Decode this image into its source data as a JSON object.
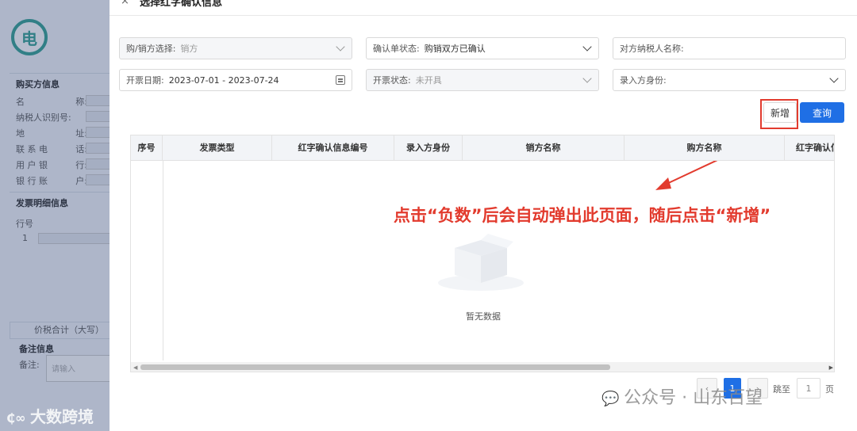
{
  "background_panel": {
    "logo_char": "电",
    "buyer_section": "购买方信息",
    "buyer_fields": [
      {
        "l": "名",
        "r": "称:"
      },
      {
        "l": "纳税人识别号:",
        "r": ""
      },
      {
        "l": "地",
        "r": "址:"
      },
      {
        "l": "联 系 电",
        "r": "话:"
      },
      {
        "l": "用 户 银",
        "r": "行:"
      },
      {
        "l": "银 行 账",
        "r": "户:"
      }
    ],
    "detail_section": "发票明细信息",
    "line_no_label": "行号",
    "line_no_value": "1",
    "total_label": "价税合计（大写）",
    "remark_section": "备注信息",
    "remark_label": "备注:",
    "remark_placeholder": "请输入"
  },
  "dialog": {
    "close_glyph": "×",
    "title": "选择红字确认信息",
    "filters": {
      "role": {
        "label": "购/销方选择:",
        "value": "销方"
      },
      "confirm_status": {
        "label": "确认单状态:",
        "value": "购销双方已确认"
      },
      "counterparty": {
        "label": "对方纳税人名称:",
        "value": ""
      },
      "date": {
        "label": "开票日期:",
        "value": "2023-07-01 - 2023-07-24"
      },
      "invoice_status": {
        "label": "开票状态:",
        "value": "未开具"
      },
      "entry_identity": {
        "label": "录入方身份:",
        "value": ""
      }
    },
    "buttons": {
      "add": "新增",
      "query": "查询"
    },
    "table": {
      "columns": [
        "序号",
        "发票类型",
        "红字确认信息编号",
        "录入方身份",
        "销方名称",
        "购方名称",
        "红字确认信息状态"
      ],
      "empty_text": "暂无数据"
    },
    "annotation": "点击“负数”后会自动弹出此页面，随后点击“新增”",
    "pagination": {
      "prev": "‹",
      "current_page": "1",
      "next": "›",
      "jump_label": "跳至",
      "jump_value": "1",
      "page_unit": "页"
    }
  },
  "watermarks": {
    "left": "大数跨境",
    "right": "公众号 · 山东百望"
  },
  "colors": {
    "primary": "#1f6fe5",
    "annotation_red": "#e23b2e"
  }
}
